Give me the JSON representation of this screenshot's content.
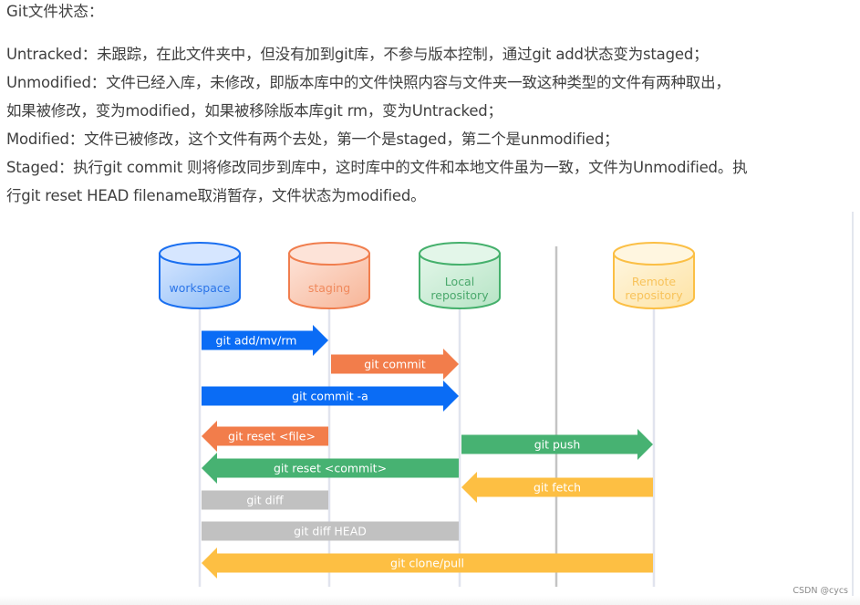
{
  "heading": "Git文件状态：",
  "paragraphs": [
    "Untracked：未跟踪，在此文件夹中，但没有加到git库，不参与版本控制，通过git add状态变为staged；",
    "Unmodified：文件已经入库，未修改，即版本库中的文件快照内容与文件夹一致这种类型的文件有两种取出，",
    "如果被修改，变为modified，如果被移除版本库git rm，变为Untracked；",
    "Modified：文件已被修改，这个文件有两个去处，第一个是staged，第二个是unmodified；",
    "Staged：执行git commit 则将修改同步到库中，这时库中的文件和本地文件虽为一致，文件为Unmodified。执",
    "行git reset HEAD filename取消暂存，文件状态为modified。"
  ],
  "diagram": {
    "stores": [
      {
        "id": "workspace",
        "lines": [
          "workspace"
        ],
        "color": "#1a6ff0",
        "fill_from": "#d6e6ff",
        "fill_to": "#8cbcf7",
        "text_color": "#2a74e8"
      },
      {
        "id": "staging",
        "lines": [
          "staging"
        ],
        "color": "#f07e4e",
        "fill_from": "#fde3d8",
        "fill_to": "#f7b597",
        "text_color": "#f0895c"
      },
      {
        "id": "local",
        "lines": [
          "Local",
          "repository"
        ],
        "color": "#45b06c",
        "fill_from": "#e3f6e9",
        "fill_to": "#b6e4c5",
        "text_color": "#4aa86c"
      },
      {
        "id": "remote",
        "lines": [
          "Remote",
          "repository"
        ],
        "color": "#fbbf45",
        "fill_from": "#fff6e0",
        "fill_to": "#fde3a4",
        "text_color": "#f8c35b"
      }
    ],
    "commands": [
      {
        "label": "git add/mv/rm",
        "from": "workspace",
        "to": "staging",
        "direction": "right",
        "color": "#0a6cf5"
      },
      {
        "label": "git commit",
        "from": "staging",
        "to": "local",
        "direction": "right",
        "color": "#f27d4b"
      },
      {
        "label": "git commit -a",
        "from": "workspace",
        "to": "local",
        "direction": "right",
        "color": "#0a6cf5"
      },
      {
        "label": "git reset <file>",
        "from": "staging",
        "to": "workspace",
        "direction": "left",
        "color": "#f27d4b"
      },
      {
        "label": "git push",
        "from": "local",
        "to": "remote",
        "direction": "right",
        "color": "#47b272"
      },
      {
        "label": "git reset <commit>",
        "from": "local",
        "to": "workspace",
        "direction": "left",
        "color": "#47b272"
      },
      {
        "label": "git fetch",
        "from": "remote",
        "to": "local",
        "direction": "left",
        "color": "#fdbf43"
      },
      {
        "label": "git diff",
        "from": "workspace",
        "to": "staging",
        "direction": "none",
        "color": "#c1c1c1"
      },
      {
        "label": "git diff HEAD",
        "from": "workspace",
        "to": "local",
        "direction": "none",
        "color": "#c1c1c1"
      },
      {
        "label": "git clone/pull",
        "from": "remote",
        "to": "workspace",
        "direction": "left",
        "color": "#fdbf43"
      }
    ]
  },
  "watermark": "CSDN @cycs"
}
